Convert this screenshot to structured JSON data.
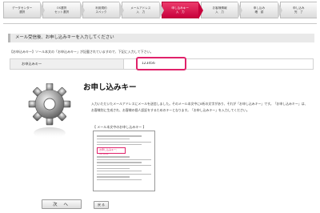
{
  "steps": [
    {
      "label": "データセンター\n選択"
    },
    {
      "label": "OS選択\nセット選択"
    },
    {
      "label": "利用規約\nスペック"
    },
    {
      "label": "メールアドレス\n入　力"
    },
    {
      "label": "申し込みキー\n入　力"
    },
    {
      "label": "お客様情報\n入　力"
    },
    {
      "label": "申し込み\n確　認"
    },
    {
      "label": "申し込み\n完　了"
    }
  ],
  "section_title": "メール受信後、お申し込みキーを入力してください",
  "note": "【お申込みキー】ソール本文の「お申込みキー」が記載されていますので、下記に入力して下さい。",
  "form": {
    "label": "お申込みキー",
    "value": "123456"
  },
  "key_title": "お申し込みキー",
  "description": "入力いただいたメールアドレスにメールを送信しました。そのメール本文中に8桁の文字があり、それが「お申し込みキー」です。「お申し込みキー」は、お客様別に生成され、お客様の個人認証をするためのキーとなります。「お申し込みキー」を入力してください。",
  "sample_caption": "【 メール本文中のお申し込みキー 】",
  "sample_key_text": "お申し込みキー：123456",
  "buttons": {
    "next": "次 へ",
    "back": "戻 る"
  }
}
